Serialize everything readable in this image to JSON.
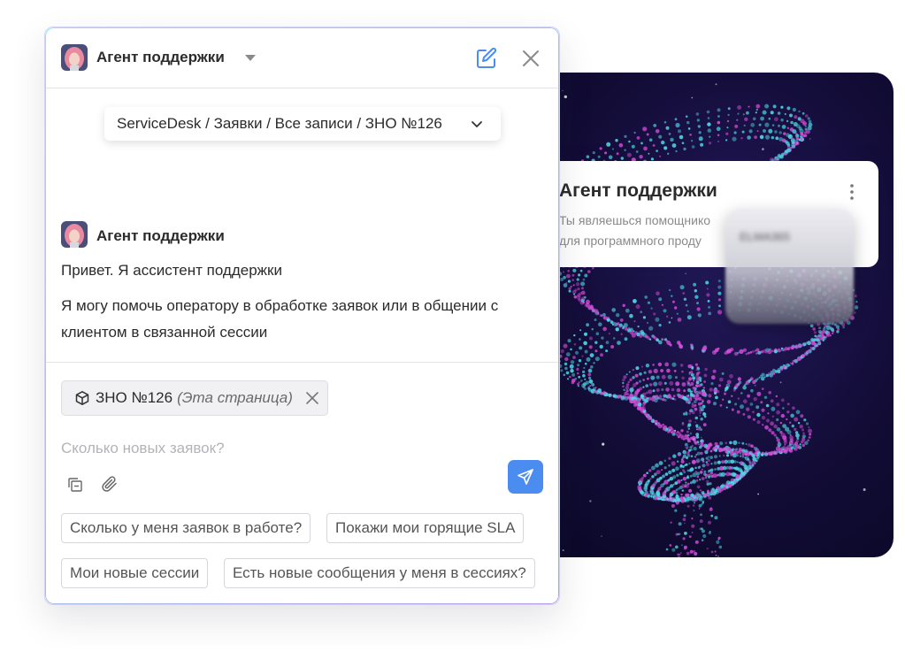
{
  "chat": {
    "header_title": "Агент поддержки",
    "breadcrumb": "ServiceDesk / Заявки / Все записи / ЗНО №126",
    "message_author": "Агент поддержки",
    "message_lines": [
      "Привет. Я ассистент поддержки",
      "Я могу помочь оператору в обработке заявок или в общении с",
      "клиентом в связанной сессии"
    ],
    "context_chip": {
      "label": "ЗНО №126",
      "note": "(Эта страница)"
    },
    "input_placeholder": "Сколько новых заявок?",
    "suggestions": [
      "Сколько у меня заявок в работе?",
      "Покажи мои горящие SLA",
      "Мои новые сессии",
      "Есть новые сообщения у меня в сессиях?"
    ]
  },
  "profile_card": {
    "name": "Агент поддержки",
    "description_lines": [
      "Ты являешься помощнико",
      "для программного проду"
    ],
    "blurred_logo_text": "ELMA365"
  },
  "colors": {
    "accent_blue": "#4a8cf0",
    "background_dark": "#120c36",
    "particle_cyan": "#4fd6e6",
    "particle_magenta": "#d24bd8"
  },
  "icons": {
    "edit": "edit-icon",
    "close": "close-icon",
    "chevron": "chevron-down-icon",
    "package": "package-icon",
    "copy": "copy-icon",
    "paperclip": "paperclip-icon",
    "send": "send-icon",
    "more": "more-vertical-icon"
  }
}
